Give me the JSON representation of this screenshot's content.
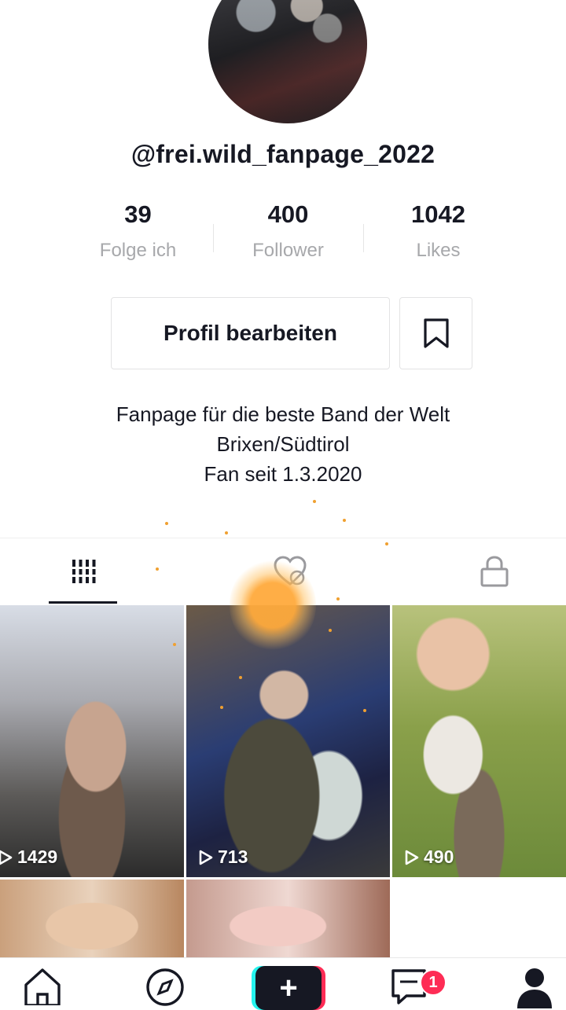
{
  "profile": {
    "username": "@frei.wild_fanpage_2022",
    "stats": [
      {
        "value": "39",
        "label": "Folge ich"
      },
      {
        "value": "400",
        "label": "Follower"
      },
      {
        "value": "1042",
        "label": "Likes"
      }
    ],
    "edit_button_label": "Profil bearbeiten",
    "bio_lines": [
      "Fanpage für die beste Band der Welt",
      "Brixen/Südtirol",
      "Fan seit 1.3.2020"
    ]
  },
  "tabs": [
    {
      "name": "videos",
      "icon": "grid-lines-icon",
      "selected": true
    },
    {
      "name": "liked",
      "icon": "heart-hidden-icon",
      "selected": false
    },
    {
      "name": "private",
      "icon": "lock-icon",
      "selected": false
    }
  ],
  "videos": [
    {
      "views": "1429"
    },
    {
      "views": "713"
    },
    {
      "views": "490"
    }
  ],
  "bottom_nav": {
    "items": [
      "home-icon",
      "discover-icon",
      "create-icon",
      "inbox-icon",
      "profile-icon"
    ],
    "inbox_badge": "1",
    "create_glyph": "+"
  },
  "colors": {
    "accent_red": "#fe2c55",
    "accent_cyan": "#25f4ee",
    "text_primary": "#161823",
    "text_secondary": "#a7a8ab"
  }
}
